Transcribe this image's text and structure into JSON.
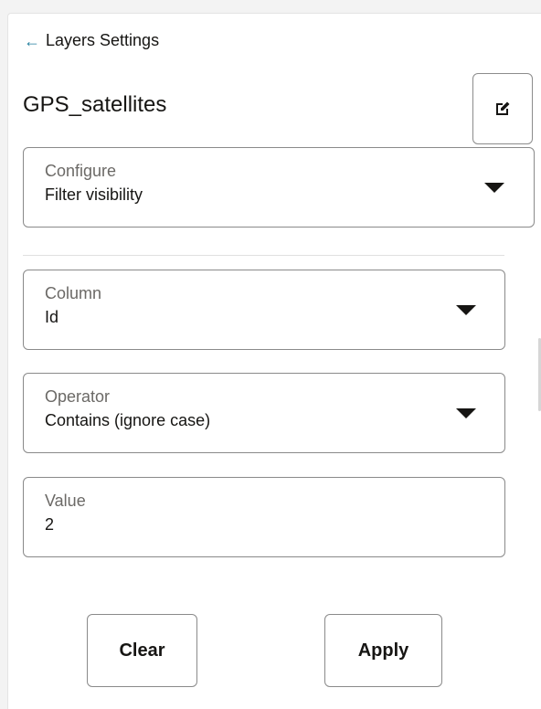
{
  "header": {
    "back_arrow": "←",
    "back_label": "Layers Settings",
    "layer_name": "GPS_satellites",
    "edit_icon": "edit-icon"
  },
  "configure": {
    "label": "Configure",
    "value": "Filter visibility"
  },
  "filter": {
    "column": {
      "label": "Column",
      "value": "Id"
    },
    "operator": {
      "label": "Operator",
      "value": "Contains (ignore case)"
    },
    "value": {
      "label": "Value",
      "value": "2"
    }
  },
  "actions": {
    "clear_label": "Clear",
    "apply_label": "Apply"
  },
  "colors": {
    "accent": "#227e9e",
    "border": "#8a8a8a",
    "label": "#6b6966",
    "text": "#161513"
  }
}
